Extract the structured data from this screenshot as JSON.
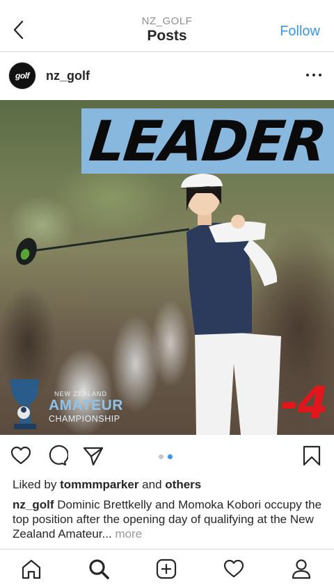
{
  "header": {
    "subtitle": "NZ_GOLF",
    "title": "Posts",
    "follow_label": "Follow"
  },
  "post": {
    "username": "nz_golf",
    "avatar_text": "golf",
    "image": {
      "banner_text": "LEADER",
      "score_text": "-4",
      "logo_line1": "NEW ZEALAND",
      "logo_line2": "AMATEUR",
      "logo_line3": "CHAMPIONSHIP"
    },
    "carousel": {
      "count": 2,
      "active_index": 1
    },
    "likes": {
      "prefix": "Liked by",
      "user": "tommmparker",
      "joiner": "and",
      "others": "others"
    },
    "caption": {
      "user": "nz_golf",
      "text": "Dominic Brettkelly and Momoka Kobori occupy the top position after the opening day of qualifying at the New Zealand Amateur...",
      "more": "more"
    }
  },
  "icons": {
    "back": "chevron-left-icon",
    "options": "more-horizontal-icon",
    "like": "heart-icon",
    "comment": "comment-icon",
    "share": "send-icon",
    "save": "bookmark-icon",
    "nav": [
      "home-icon",
      "search-icon",
      "add-post-icon",
      "activity-heart-icon",
      "profile-icon"
    ]
  },
  "colors": {
    "accent": "#3897f0",
    "banner": "#89b8de",
    "score": "#e3171b"
  }
}
